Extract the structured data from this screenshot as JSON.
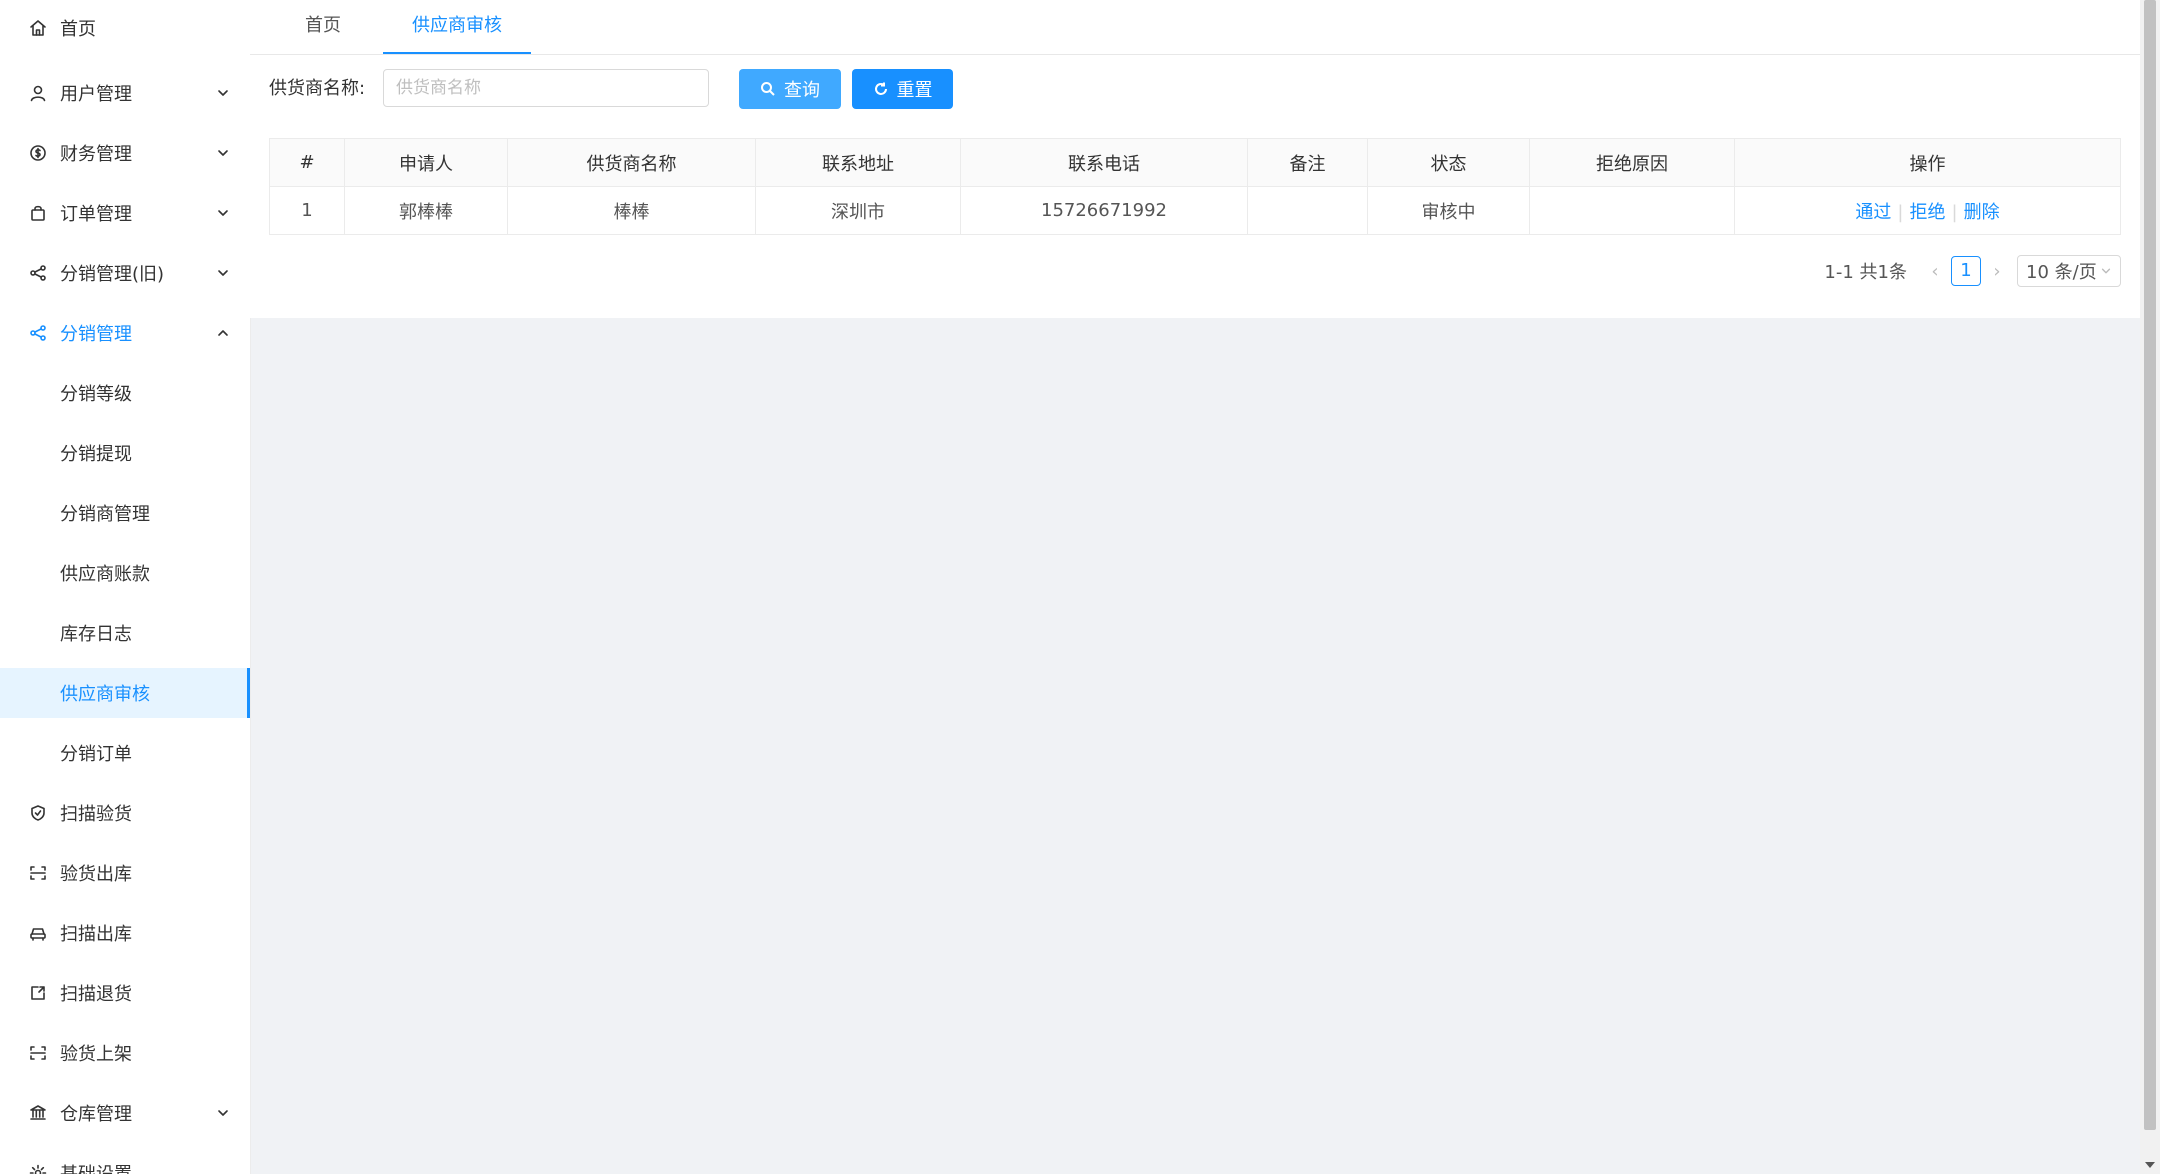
{
  "sidebar": {
    "items": [
      {
        "label": "首页",
        "icon": "home-icon"
      },
      {
        "label": "用户管理",
        "icon": "user-icon"
      },
      {
        "label": "财务管理",
        "icon": "money-icon"
      },
      {
        "label": "订单管理",
        "icon": "bag-icon"
      },
      {
        "label": "分销管理(旧)",
        "icon": "share-icon"
      },
      {
        "label": "分销管理",
        "icon": "share-icon"
      },
      {
        "label": "分销等级"
      },
      {
        "label": "分销提现"
      },
      {
        "label": "分销商管理"
      },
      {
        "label": "供应商账款"
      },
      {
        "label": "库存日志"
      },
      {
        "label": "供应商审核"
      },
      {
        "label": "分销订单"
      },
      {
        "label": "扫描验货",
        "icon": "shield-icon"
      },
      {
        "label": "验货出库",
        "icon": "scan-icon"
      },
      {
        "label": "扫描出库",
        "icon": "car-icon"
      },
      {
        "label": "扫描退货",
        "icon": "return-icon"
      },
      {
        "label": "验货上架",
        "icon": "scan-icon"
      },
      {
        "label": "仓库管理",
        "icon": "bank-icon"
      },
      {
        "label": "基础设置",
        "icon": "gear-icon"
      }
    ]
  },
  "tabs": [
    {
      "label": "首页"
    },
    {
      "label": "供应商审核"
    }
  ],
  "filter": {
    "label": "供货商名称:",
    "placeholder": "供货商名称",
    "value": "",
    "query_label": "查询",
    "reset_label": "重置"
  },
  "table": {
    "headers": [
      "#",
      "申请人",
      "供货商名称",
      "联系地址",
      "联系电话",
      "备注",
      "状态",
      "拒绝原因",
      "操作"
    ],
    "rows": [
      {
        "index": "1",
        "applicant": "郭棒棒",
        "supplier": "棒棒",
        "address": "深圳市",
        "phone": "15726671992",
        "remark": "",
        "status": "审核中",
        "reason": "",
        "actions": [
          "通过",
          "拒绝",
          "删除"
        ]
      }
    ]
  },
  "pagination": {
    "total_text": "1-1 共1条",
    "current_page": "1",
    "page_size": "10 条/页"
  },
  "colors": {
    "primary": "#1890ff",
    "query_button": "#40a9ff",
    "background": "#f0f2f5"
  }
}
